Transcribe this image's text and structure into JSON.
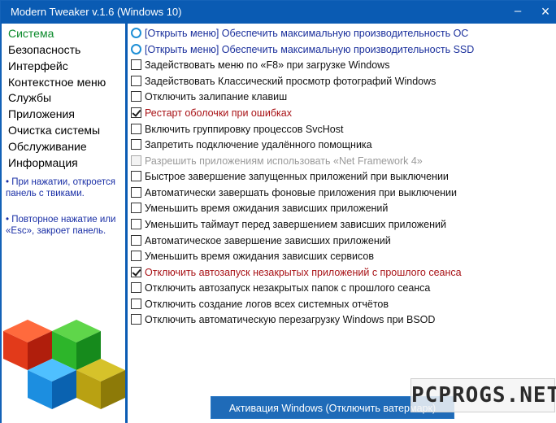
{
  "window": {
    "title": "Modern Tweaker v.1.6 (Windows 10)",
    "minimize_glyph": "–",
    "close_glyph": "×"
  },
  "sidebar": {
    "items": [
      {
        "label": "Система",
        "active": true
      },
      {
        "label": "Безопасность"
      },
      {
        "label": "Интерфейс"
      },
      {
        "label": "Контекстное меню"
      },
      {
        "label": "Службы"
      },
      {
        "label": "Приложения"
      },
      {
        "label": "Очистка системы"
      },
      {
        "label": "Обслуживание"
      },
      {
        "label": "Информация"
      }
    ],
    "hints": [
      "• При нажатии, откроется панель с твиками.",
      "• Повторное нажатие или «Esc», закроет панель."
    ]
  },
  "options": [
    {
      "type": "radio",
      "label": "[Открыть меню] Обеспечить максимальную производительность ОС",
      "style": "blue"
    },
    {
      "type": "radio",
      "label": "[Открыть меню] Обеспечить максимальную производительность SSD",
      "style": "blue"
    },
    {
      "type": "checkbox",
      "label": "Задействовать меню по «F8» при загрузке Windows",
      "checked": false
    },
    {
      "type": "checkbox",
      "label": "Задействовать Классический просмотр фотографий Windows",
      "checked": false
    },
    {
      "type": "checkbox",
      "label": "Отключить залипание клавиш",
      "checked": false
    },
    {
      "type": "checkbox",
      "label": "Рестарт оболочки при ошибках",
      "checked": true,
      "style": "red"
    },
    {
      "type": "checkbox",
      "label": "Включить группировку процессов SvcHost",
      "checked": false
    },
    {
      "type": "checkbox",
      "label": "Запретить подключение удалённого помощника",
      "checked": false
    },
    {
      "type": "checkbox",
      "label": "Разрешить приложениям использовать «Net Framework 4»",
      "checked": false,
      "disabled": true
    },
    {
      "type": "checkbox",
      "label": "Быстрое завершение запущенных приложений при выключении",
      "checked": false
    },
    {
      "type": "checkbox",
      "label": "Автоматически завершать фоновые приложения при выключении",
      "checked": false
    },
    {
      "type": "checkbox",
      "label": "Уменьшить время ожидания зависших приложений",
      "checked": false
    },
    {
      "type": "checkbox",
      "label": "Уменьшить таймаут перед завершением зависших приложений",
      "checked": false
    },
    {
      "type": "checkbox",
      "label": "Автоматическое завершение зависших приложений",
      "checked": false
    },
    {
      "type": "checkbox",
      "label": "Уменьшить время ожидания зависших сервисов",
      "checked": false
    },
    {
      "type": "checkbox",
      "label": "Отключить автозапуск незакрытых приложений с прошлого сеанса",
      "checked": true,
      "style": "red"
    },
    {
      "type": "checkbox",
      "label": "Отключить автозапуск незакрытых папок с прошлого сеанса",
      "checked": false
    },
    {
      "type": "checkbox",
      "label": "Отключить создание логов всех системных отчётов",
      "checked": false
    },
    {
      "type": "checkbox",
      "label": "Отключить автоматическую перезагрузку Windows при BSOD",
      "checked": false
    }
  ],
  "activate_button": {
    "label": "Активация Windows (Отключить ватермарк)"
  },
  "watermark": {
    "text": "PCPROGS.NET"
  },
  "colors": {
    "titlebar": "#0a5bb3",
    "active_nav": "#0a8a2a",
    "hint_text": "#1a2fa6",
    "highlight_red": "#a81216",
    "radio_blue": "#1e8fd6"
  }
}
